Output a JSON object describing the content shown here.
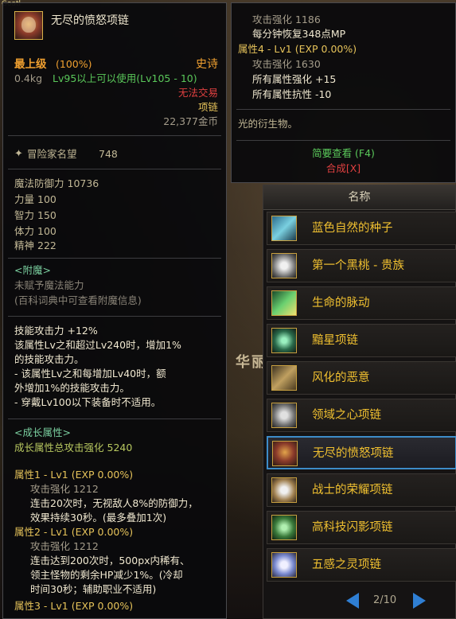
{
  "corner_text": "Goatl",
  "scene_text": "华丽",
  "item": {
    "name": "无尽的愤怒项链",
    "grade_label": "最上级",
    "grade_pct": "(100%)",
    "rarity": "史诗",
    "weight": "0.4kg",
    "level_req": "Lv95以上可以使用(Lv105 - 10)",
    "trade": "无法交易",
    "type": "项链",
    "price": "22,377金币",
    "fame_label": "冒险家名望",
    "fame_value": "748",
    "stats": [
      {
        "label": "魔法防御力",
        "value": "10736"
      },
      {
        "label": "力量",
        "value": "100"
      },
      {
        "label": "智力",
        "value": "150"
      },
      {
        "label": "体力",
        "value": "100"
      },
      {
        "label": "精神",
        "value": "222"
      }
    ],
    "enchant_title": "<附魔>",
    "enchant_line1": "未赋予魔法能力",
    "enchant_line2": "(百科词典中可查看附魔信息)",
    "skill_lines": [
      "技能攻击力 +12%",
      "该属性Lv之和超过Lv240时，增加1%",
      "的技能攻击力。",
      "- 该属性Lv之和每增加Lv40时，额",
      "外增加1%的技能攻击力。",
      "- 穿戴Lv100以下装备时不适用。"
    ],
    "growth_title": "<成长属性>",
    "growth_total_label": "成长属性总攻击强化",
    "growth_total_value": "5240",
    "attr1_title": "属性1 - Lv1 (EXP 0.00%)",
    "attr1_stat": "攻击强化 1212",
    "attr1_lines": [
      "连击20次时，无视敌人8%的防御力，",
      "效果持续30秒。(最多叠加1次)"
    ],
    "attr2_title": "属性2 - Lv1 (EXP 0.00%)",
    "attr2_stat": "攻击强化 1212",
    "attr2_lines": [
      "连击达到200次时，500px内稀有、",
      "领主怪物的剩余HP减少1%。(冷却",
      "时间30秒；辅助职业不适用)"
    ],
    "attr3_title": "属性3 - Lv1 (EXP 0.00%)"
  },
  "tooltip2": {
    "line1": "攻击强化 1186",
    "line2": "每分钟恢复348点MP",
    "attr4_title": "属性4 - Lv1 (EXP 0.00%)",
    "line4": "攻击强化 1630",
    "line5": "所有属性强化 +15",
    "line6": "所有属性抗性 -10",
    "flavor": "光的衍生物。",
    "summary_link": "简要查看 (F4)",
    "compose_link": "合成[X]"
  },
  "list": {
    "header": "名称",
    "items": [
      {
        "label": "蓝色自然的种子",
        "icon": "seed-icon"
      },
      {
        "label": "第一个黑桃 - 贵族",
        "icon": "spade-icon"
      },
      {
        "label": "生命的脉动",
        "icon": "pulse-icon"
      },
      {
        "label": "黯星项链",
        "icon": "star-necklace-icon"
      },
      {
        "label": "风化的恶意",
        "icon": "malice-icon"
      },
      {
        "label": "领域之心项链",
        "icon": "heart-necklace-icon"
      },
      {
        "label": "无尽的愤怒项链",
        "icon": "rage-necklace-icon"
      },
      {
        "label": "战士的荣耀项链",
        "icon": "glory-necklace-icon"
      },
      {
        "label": "高科技闪影项链",
        "icon": "tech-necklace-icon"
      },
      {
        "label": "五感之灵项链",
        "icon": "spirit-necklace-icon"
      }
    ],
    "selected_index": 6,
    "page": "2/10"
  },
  "colors": {
    "selected_border": "#3d8cc8",
    "epic": "#f0a030",
    "gold": "#f0c030"
  }
}
